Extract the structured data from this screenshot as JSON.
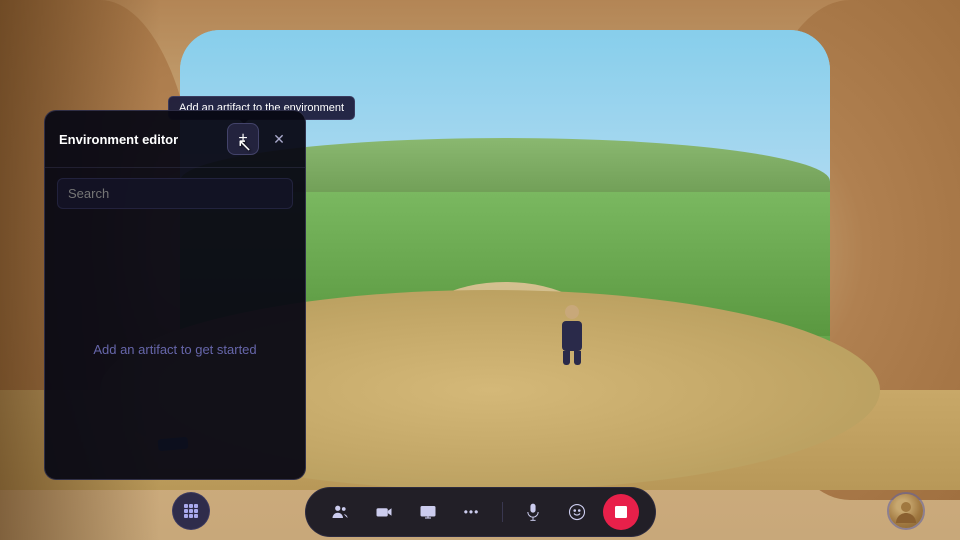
{
  "environment": {
    "bg_color": "#c8a87a"
  },
  "tooltip": {
    "text": "Add an artifact to the environment"
  },
  "editor_panel": {
    "title": "Environment editor",
    "add_button_label": "+",
    "close_button_label": "✕",
    "search_placeholder": "Search",
    "empty_state_text": "Add an artifact to get started"
  },
  "toolbar": {
    "buttons": [
      {
        "name": "people-icon",
        "symbol": "👥",
        "active": false
      },
      {
        "name": "camera-icon",
        "symbol": "🎥",
        "active": false
      },
      {
        "name": "screen-share-icon",
        "symbol": "🖥",
        "active": false
      },
      {
        "name": "more-icon",
        "symbol": "···",
        "active": false
      },
      {
        "name": "mic-icon",
        "symbol": "🎤",
        "active": false
      },
      {
        "name": "emoji-icon",
        "symbol": "🙂",
        "active": false
      },
      {
        "name": "artifact-icon",
        "symbol": "⬛",
        "active": true
      }
    ],
    "left_btn_symbol": "⋮⋮⋮",
    "right_avatar_label": "avatar"
  }
}
